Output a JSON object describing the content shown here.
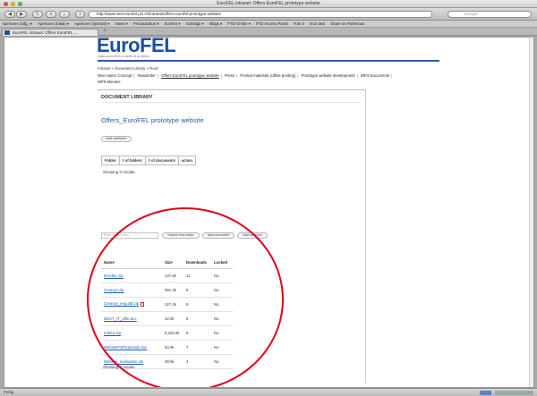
{
  "window": {
    "title": "EuroFEL intranet: Offers EuroFEL prototype website"
  },
  "toolbar": {
    "back": "◀",
    "forward": "▶",
    "reload": "↻",
    "stop": "✕",
    "home": "⌂",
    "plus": "+",
    "url": "http://www-test-eurofel.psi.ch/intranet/offers-eurofel-prototype-website",
    "search_placeholder": "Google"
  },
  "bookmarks": [
    "Apertures (alfg.) ▾",
    "Apertures (lokal) ▾",
    "Apertures (spezial) ▾",
    "News ▾",
    "Precausation ▾",
    "Suchen ▾",
    "Sonstige ▾",
    "Blogs ▾",
    "FTD-Online ▾",
    "FTD Access Portal",
    "Yum It",
    "leuz desi",
    "Share on Posterous"
  ],
  "tab": {
    "label": "EuroFEL intranet: Offers EuroFEL ...",
    "new_tab": "+"
  },
  "site": {
    "logo": "EuroFEL",
    "logo_sub": "FREE ELECTRON LASERS IN EUROPE",
    "breadcrumb": {
      "items": [
        "Intranet",
        "Document Library",
        "Root"
      ],
      "sep": "»"
    },
    "nav": [
      "New Users Concept",
      "Newsletter",
      "Offers EuroFEL prototype website",
      "Press",
      "Printed materials (offset printing)",
      "Prototype website development",
      "WP3 Documents",
      "WP5 Minutes"
    ]
  },
  "library": {
    "heading": "DOCUMENT LIBRARY",
    "folder_title": "Offers_EuroFEL prototype website",
    "add_subfolder": "Add subfolder",
    "meta_headers": [
      "Folder",
      "# of folders",
      "# of documents",
      "action"
    ],
    "showing_folders": "Showing 0 results.",
    "search_placeholder": "Enter search keys",
    "search_button": "Search this folder",
    "add_document": "Add document",
    "add_shortcut": "Add shortcut",
    "files_headers": [
      "Name",
      "Size",
      "Downloads",
      "Locked"
    ],
    "files": [
      {
        "name": "BASIEL.zip",
        "size": "137.6k",
        "downloads": "11",
        "locked": "No"
      },
      {
        "name": "Creasys.zip",
        "size": "591.3k",
        "downloads": "6",
        "locked": "No"
      },
      {
        "name": "Creasys_eng.pdf.zip",
        "size": "127.4k",
        "downloads": "9",
        "locked": "No",
        "icon": "pdf-icon"
      },
      {
        "name": "DESY_IT_offer.doc",
        "size": "42.0k",
        "downloads": "9",
        "locked": "No"
      },
      {
        "name": "Intefra.zip",
        "size": "6,425.0k",
        "downloads": "8",
        "locked": "No"
      },
      {
        "name": "WebsiteFSProposal2.doc",
        "size": "53.0k",
        "downloads": "7",
        "locked": "No"
      },
      {
        "name": "Website_evaluation.xls",
        "size": "38.5k",
        "downloads": "4",
        "locked": "No"
      }
    ],
    "showing_files": "Showing 7 results."
  },
  "status": {
    "text": "Fertig"
  },
  "colors": {
    "brand_blue": "#1c4f9e",
    "link_blue": "#1f5aa8",
    "annotation_red": "#e0001a"
  }
}
